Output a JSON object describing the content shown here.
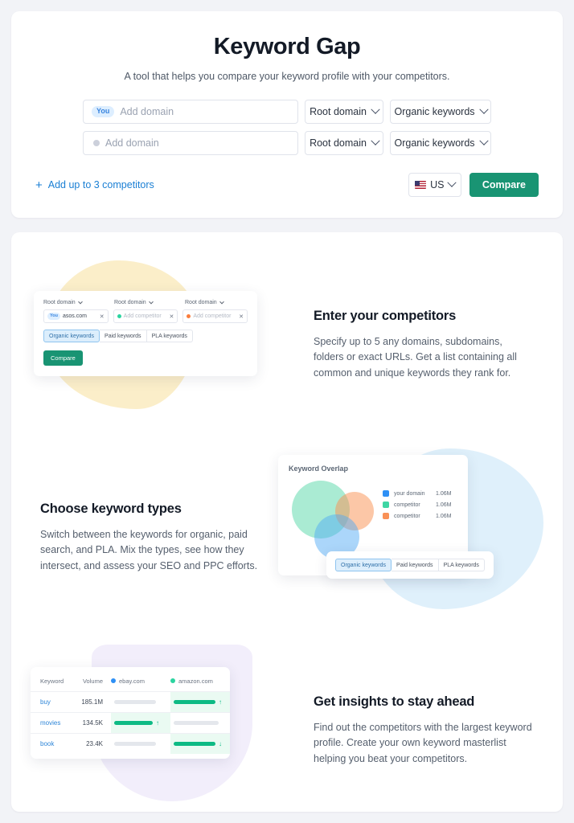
{
  "hero": {
    "title": "Keyword Gap",
    "subtitle": "A tool that helps you compare your keyword profile with your competitors.",
    "rows": [
      {
        "badge": "You",
        "placeholder": "Add domain",
        "value": "",
        "scope": "Root domain",
        "keyword_type": "Organic keywords"
      },
      {
        "badge": "",
        "placeholder": "Add domain",
        "value": "",
        "scope": "Root domain",
        "keyword_type": "Organic keywords"
      }
    ],
    "add_competitors_label": "Add up to 3 competitors",
    "add_icon": "+",
    "country": "US",
    "compare_label": "Compare"
  },
  "features": [
    {
      "heading": "Enter your competitors",
      "body": "Specify up to 5 any domains, subdomains, folders or exact URLs. Get a list containing all common and unique keywords they rank for.",
      "figure": {
        "selects": [
          "Root domain",
          "Root domain",
          "Root domain"
        ],
        "inputs": [
          {
            "badge": "You",
            "value": "asos.com",
            "placeholder": ""
          },
          {
            "badge": "",
            "value": "",
            "placeholder": "Add competitor"
          },
          {
            "badge": "",
            "value": "",
            "placeholder": "Add competitor"
          }
        ],
        "tabs": [
          "Organic keywords",
          "Paid keywords",
          "PLA keywords"
        ],
        "active_tab": "Organic keywords",
        "compare_label": "Compare"
      }
    },
    {
      "heading": "Choose keyword types",
      "body": "Switch between the keywords for organic, paid search, and PLA. Mix the types, see how they intersect, and assess your SEO and PPC efforts.",
      "figure": {
        "title": "Keyword Overlap",
        "legend": [
          {
            "name": "your domain",
            "value": "1.06M",
            "color": "#2e90f5"
          },
          {
            "name": "competitor",
            "value": "1.06M",
            "color": "#3fd6a4"
          },
          {
            "name": "competitor",
            "value": "1.06M",
            "color": "#f99157"
          }
        ],
        "tabs": [
          "Organic keywords",
          "Paid keywords",
          "PLA keywords"
        ],
        "active_tab": "Organic keywords"
      }
    },
    {
      "heading": "Get insights to stay ahead",
      "body": "Find out the competitors with the largest keyword profile. Create your own keyword masterlist helping you beat your competitors.",
      "figure": {
        "columns": [
          "Keyword",
          "Volume",
          "ebay.com",
          "amazon.com"
        ],
        "rows": [
          {
            "keyword": "buy",
            "volume": "185.1M",
            "ebay_filled": false,
            "ebay_arrow": "",
            "amazon_filled": true,
            "amazon_arrow": "↑"
          },
          {
            "keyword": "movies",
            "volume": "134.5K",
            "ebay_filled": true,
            "ebay_arrow": "↑",
            "amazon_filled": false,
            "amazon_arrow": ""
          },
          {
            "keyword": "book",
            "volume": "23.4K",
            "ebay_filled": false,
            "ebay_arrow": "",
            "amazon_filled": true,
            "amazon_arrow": "↓"
          }
        ]
      }
    }
  ],
  "chart_data": {
    "type": "table",
    "title": "Keyword Overlap",
    "venn": {
      "type": "pie",
      "categories": [
        "your domain",
        "competitor",
        "competitor"
      ],
      "values": [
        "1.06M",
        "1.06M",
        "1.06M"
      ],
      "colors": [
        "#2e90f5",
        "#3fd6a4",
        "#f99157"
      ]
    },
    "keyword_table": {
      "columns": [
        "Keyword",
        "Volume",
        "ebay.com",
        "amazon.com"
      ],
      "rows": [
        [
          "buy",
          "185.1M",
          "",
          "↑"
        ],
        [
          "movies",
          "134.5K",
          "↑",
          ""
        ],
        [
          "book",
          "23.4K",
          "",
          "↓"
        ]
      ]
    }
  },
  "colors": {
    "page_bg": "#f2f3f7",
    "accent_green": "#199473",
    "accent_blue": "#1a7fd4",
    "blob_yellow": "#fbeec9",
    "blob_blue": "#dff0fb",
    "blob_purple": "#f2eefb"
  }
}
